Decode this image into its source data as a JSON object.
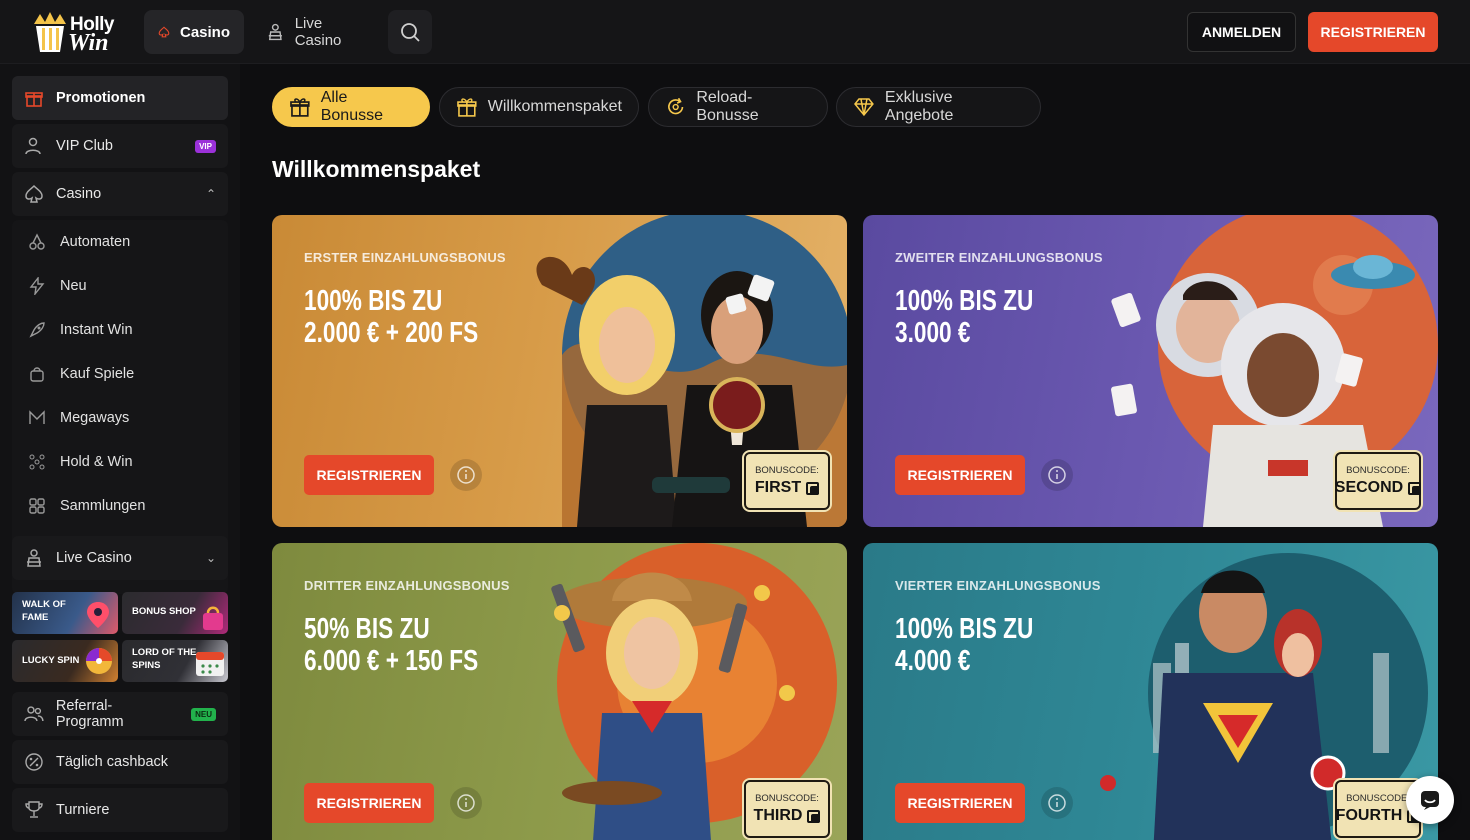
{
  "brand": {
    "line1": "Holly",
    "line2": "Win"
  },
  "topnav": {
    "casino": "Casino",
    "live_casino": "Live Casino"
  },
  "auth": {
    "login": "ANMELDEN",
    "register": "REGISTRIEREN"
  },
  "sidebar": {
    "promotions": "Promotionen",
    "vip": {
      "label": "VIP Club",
      "badge": "VIP"
    },
    "casino": "Casino",
    "sub": [
      "Automaten",
      "Neu",
      "Instant Win",
      "Kauf Spiele",
      "Megaways",
      "Hold & Win",
      "Sammlungen"
    ],
    "live_casino": "Live Casino",
    "tiles": [
      "WALK OF FAME",
      "BONUS SHOP",
      "LUCKY SPIN",
      "LORD OF THE SPINS"
    ],
    "referral": {
      "label": "Referral-Programm",
      "badge": "NEU"
    },
    "cashback": "Täglich cashback",
    "tournaments": "Turniere"
  },
  "tabs": [
    "Alle Bonusse",
    "Willkommenspaket",
    "Reload-Bonusse",
    "Exklusive Angebote"
  ],
  "section_title": "Willkommenspaket",
  "cards": [
    {
      "kicker": "ERSTER EINZAHLUNGSBONUS",
      "line1": "100% BIS ZU",
      "line2": "2.000 € + 200 FS",
      "cta": "REGISTRIEREN",
      "code_label": "BONUSCODE:",
      "code": "FIRST"
    },
    {
      "kicker": "ZWEITER EINZAHLUNGSBONUS",
      "line1": "100% BIS ZU",
      "line2": "3.000 €",
      "cta": "REGISTRIEREN",
      "code_label": "BONUSCODE:",
      "code": "SECOND"
    },
    {
      "kicker": "DRITTER EINZAHLUNGSBONUS",
      "line1": "50% BIS ZU",
      "line2": "6.000 € + 150 FS",
      "cta": "REGISTRIEREN",
      "code_label": "BONUSCODE:",
      "code": "THIRD"
    },
    {
      "kicker": "VIERTER EINZAHLUNGSBONUS",
      "line1": "100% BIS ZU",
      "line2": "4.000 €",
      "cta": "REGISTRIEREN",
      "code_label": "BONUSCODE:",
      "code": "FOURTH"
    }
  ],
  "colors": {
    "accent": "#e5482a",
    "tab_active": "#f6c84c",
    "background": "#0e0e10"
  }
}
